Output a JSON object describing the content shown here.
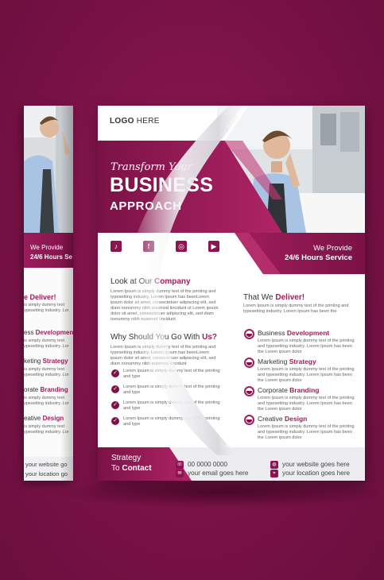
{
  "roll": {
    "provide1": "We Provide",
    "provide2": "24/6 Hours Se",
    "deliver": "e Deliver!",
    "s1_pre": "ess ",
    "s1_b": "Development",
    "s2_pre": "keting ",
    "s2_b": "Strategy",
    "s3_pre": "orate ",
    "s3_b": "Branding",
    "s4_pre": "eative ",
    "s4_b": "Design",
    "lorem1": "is simply dummy text",
    "lorem2": "ypesetting industry. Lor",
    "web": "your website go",
    "loc": "your location go"
  },
  "flyer": {
    "logo_bold": "LOGO",
    "logo_rest": " HERE",
    "script": "Transform Your",
    "title": "BUSINESS",
    "subtitle": "APPROACH",
    "we_provide": "We Provide",
    "hours": "24/6 Hours Service",
    "company_pre": "Look at Our ",
    "company_b": "Company",
    "company_text": "Lorem Ipsum is simply dummy text of the printing and typesetting industry. Lorem Ipsum has beenLorem ipsum dolor sit amet, consectetuer adipiscing elit, sed diam nonummy nibh euismod tincidunt ut Lorem ipsum dolor sit amet, consectetuer adipiscing elit, sed diam nonummy nibh euismod tincidunt",
    "why_pre": "Why Should You Go With ",
    "why_b": "Us?",
    "why_text": "Lorem Ipsum is simply dummy text of the printing and typesetting industry. Lorem Ipsum has beenLorem ipsum dolor sit amet, consectetuer adipiscing elit, sed diam nonummy nibh euismod tincidunt",
    "check_text": "Lorem Ipsum is simply dummy text of the printing and type",
    "deliver_pre": "That We ",
    "deliver_b": "Deliver!",
    "deliver_text": "Lorem Ipsum is simply dummy text of the printing and typesetting industry. Lorem Ipsum has been the",
    "services": [
      {
        "pre": "Business ",
        "b": "Development"
      },
      {
        "pre": "Marketing ",
        "b": "Strategy"
      },
      {
        "pre": "Corporate ",
        "b": "Branding"
      },
      {
        "pre": "Creative ",
        "b": "Design"
      }
    ],
    "service_text": "Lorem Ipsum is simply dummy text of the printing and typesetting industry. Lorem Ipsum has been the Lorem ipsum dolor",
    "strategy": "Strategy",
    "to": "To ",
    "contact": "Contact",
    "phone": "00 0000 0000",
    "email": "your email goes here",
    "website": "your website goes here",
    "location": "your location goes here"
  },
  "icons": {
    "tiktok": "♪",
    "facebook": "f",
    "instagram": "◎",
    "youtube": "▶"
  },
  "colors": {
    "background": "#7c1349",
    "accent": "#a01e5b",
    "dark_accent": "#7e1248"
  }
}
